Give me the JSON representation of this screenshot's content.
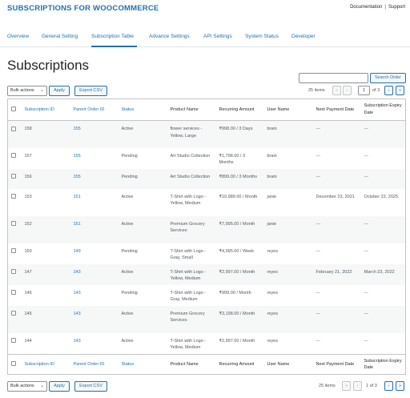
{
  "app": {
    "brand": "SUBSCRIPTIONS FOR WOOCOMMERCE",
    "links": [
      "Documentation",
      "Support"
    ],
    "link_separator": "|"
  },
  "tabs": [
    {
      "label": "Overview"
    },
    {
      "label": "General Setting"
    },
    {
      "label": "Subscription Table",
      "active": true
    },
    {
      "label": "Advance Settings"
    },
    {
      "label": "API Settings"
    },
    {
      "label": "System Status"
    },
    {
      "label": "Developer"
    }
  ],
  "page": {
    "title": "Subscriptions",
    "search_button": "Search Order",
    "search_value": ""
  },
  "toolbar_top": {
    "bulk_actions": "Bulk actions",
    "apply": "Apply",
    "export": "Export CSV",
    "items": "25 items",
    "page": "1",
    "of_pages": "of 3",
    "first": "«",
    "prev": "‹",
    "next": "›",
    "last": "»"
  },
  "toolbar_bottom": {
    "bulk_actions": "Bulk actions",
    "apply": "Apply",
    "export": "Export CSV",
    "items": "25 items",
    "page_text": "1 of 3",
    "first": "«",
    "prev": "‹",
    "next": "›",
    "last": "»"
  },
  "table": {
    "columns": [
      "Subscription ID",
      "Parent Order ID",
      "Status",
      "Product Name",
      "Recurring Amount",
      "User Name",
      "Next Payment Date",
      "Subscription Expiry Date"
    ],
    "rows": [
      {
        "id": "158",
        "parent": "155",
        "status": "Active",
        "product": "flower services - Yellow, Large",
        "amount": "₹998.00 / 3 Days",
        "user": "brain",
        "next": "---",
        "expiry": "---"
      },
      {
        "id": "157",
        "parent": "155",
        "status": "Pending",
        "product": "Art Studio Collection",
        "amount": "₹1,798.00 / 3 Months",
        "user": "brain",
        "next": "---",
        "expiry": "---"
      },
      {
        "id": "156",
        "parent": "155",
        "status": "Pending",
        "product": "Art Studio Collection",
        "amount": "₹899.00 / 3 Months",
        "user": "brain",
        "next": "---",
        "expiry": "---"
      },
      {
        "id": "153",
        "parent": "151",
        "status": "Active",
        "product": "T-Shirt with Logo - Yellow, Medium",
        "amount": "₹10,989.00 / Month",
        "user": "janie",
        "next": "December 23, 2021",
        "expiry": "October 23, 2025"
      },
      {
        "id": "152",
        "parent": "151",
        "status": "Active",
        "product": "Premium Grocery Services",
        "amount": "₹7,995.00 / Month",
        "user": "janie",
        "next": "---",
        "expiry": "---"
      },
      {
        "id": "150",
        "parent": "149",
        "status": "Pending",
        "product": "T-Shirt with Logo - Gray, Small",
        "amount": "₹4,995.00 / Week",
        "user": "reyes",
        "next": "---",
        "expiry": "---"
      },
      {
        "id": "147",
        "parent": "143",
        "status": "Active",
        "product": "T-Shirt with Logo - Yellow, Medium",
        "amount": "₹2,997.00 / Month",
        "user": "reyes",
        "next": "February 21, 2022",
        "expiry": "March 23, 2022"
      },
      {
        "id": "146",
        "parent": "143",
        "status": "Pending",
        "product": "T-Shirt with Logo - Gray, Medium",
        "amount": "₹999.00 / Month",
        "user": "reyes",
        "next": "---",
        "expiry": "---"
      },
      {
        "id": "145",
        "parent": "143",
        "status": "Active",
        "product": "Premium Grocery Services",
        "amount": "₹3,198.00 / Month",
        "user": "reyes",
        "next": "---",
        "expiry": "---"
      },
      {
        "id": "144",
        "parent": "143",
        "status": "Active",
        "product": "T-Shirt with Logo - Yellow, Medium",
        "amount": "₹2,997.00 / Month",
        "user": "reyes",
        "next": "---",
        "expiry": "---"
      }
    ]
  },
  "colors": {
    "accent": "#2271b1",
    "row_alt": "#f6f7f7",
    "border": "#c3c4c7"
  }
}
